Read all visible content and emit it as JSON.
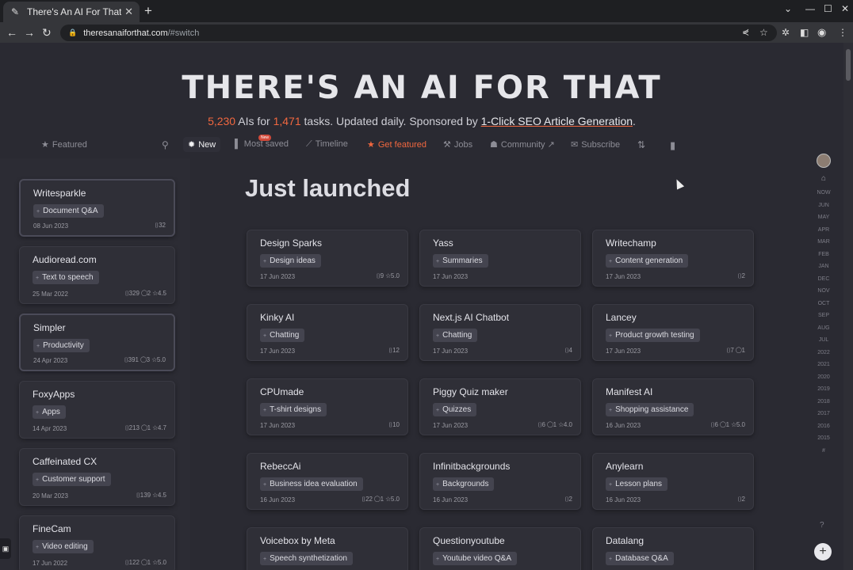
{
  "browser": {
    "tab_title": "There's An AI For That - Th",
    "new_tab": "+",
    "url_host": "theresanaiforthat.com",
    "url_path": "/#switch"
  },
  "hero": {
    "title": "THERE'S AN AI FOR THAT",
    "ai_count": "5,230",
    "ais_for": "AIs for",
    "task_count": "1,471",
    "tasks_text": "tasks. Updated daily. Sponsored by",
    "sponsor": "1-Click SEO Article Generation",
    "period": "."
  },
  "nav": {
    "featured": "Featured",
    "new": "New",
    "new_badge": "New",
    "most_saved": "Most saved",
    "timeline": "Timeline",
    "get_featured": "Get featured",
    "jobs": "Jobs",
    "community": "Community",
    "subscribe": "Subscribe"
  },
  "sidebar": {
    "items": [
      {
        "name": "Writesparkle",
        "tag": "Document Q&A",
        "date": "08 Jun 2023",
        "stats": "⌷32"
      },
      {
        "name": "Audioread.com",
        "tag": "Text to speech",
        "date": "25 Mar 2022",
        "stats": "⌷329  ◯2  ☆4.5"
      },
      {
        "name": "Simpler",
        "tag": "Productivity",
        "date": "24 Apr 2023",
        "stats": "⌷391  ◯3  ☆5.0"
      },
      {
        "name": "FoxyApps",
        "tag": "Apps",
        "date": "14 Apr 2023",
        "stats": "⌷213  ◯1  ☆4.7"
      },
      {
        "name": "Caffeinated CX",
        "tag": "Customer support",
        "date": "20 Mar 2023",
        "stats": "⌷139  ☆4.5"
      },
      {
        "name": "FineCam",
        "tag": "Video editing",
        "date": "17 Jun 2022",
        "stats": "⌷122  ◯1  ☆5.0"
      }
    ]
  },
  "main": {
    "title": "Just launched",
    "cards": [
      {
        "name": "Design Sparks",
        "tag": "Design ideas",
        "date": "17 Jun 2023",
        "stats": "⌷9  ☆5.0"
      },
      {
        "name": "Yass",
        "tag": "Summaries",
        "date": "17 Jun 2023",
        "stats": ""
      },
      {
        "name": "Writechamp",
        "tag": "Content generation",
        "date": "17 Jun 2023",
        "stats": "⌷2"
      },
      {
        "name": "Kinky AI",
        "tag": "Chatting",
        "date": "17 Jun 2023",
        "stats": "⌷12"
      },
      {
        "name": "Next.js AI Chatbot",
        "tag": "Chatting",
        "date": "17 Jun 2023",
        "stats": "⌷4"
      },
      {
        "name": "Lancey",
        "tag": "Product growth testing",
        "date": "17 Jun 2023",
        "stats": "⌷7  ◯1"
      },
      {
        "name": "CPUmade",
        "tag": "T-shirt designs",
        "date": "17 Jun 2023",
        "stats": "⌷10"
      },
      {
        "name": "Piggy Quiz maker",
        "tag": "Quizzes",
        "date": "17 Jun 2023",
        "stats": "⌷6  ◯1  ☆4.0"
      },
      {
        "name": "Manifest AI",
        "tag": "Shopping assistance",
        "date": "16 Jun 2023",
        "stats": "⌷6  ◯1  ☆5.0"
      },
      {
        "name": "RebeccAi",
        "tag": "Business idea evaluation",
        "date": "16 Jun 2023",
        "stats": "⌷22  ◯1  ☆5.0"
      },
      {
        "name": "Infinitbackgrounds",
        "tag": "Backgrounds",
        "date": "16 Jun 2023",
        "stats": "⌷2"
      },
      {
        "name": "Anylearn",
        "tag": "Lesson plans",
        "date": "16 Jun 2023",
        "stats": "⌷2"
      },
      {
        "name": "Voicebox by Meta",
        "tag": "Speech synthetization",
        "date": "",
        "stats": ""
      },
      {
        "name": "Questionyoutube",
        "tag": "Youtube video Q&A",
        "date": "",
        "stats": ""
      },
      {
        "name": "Datalang",
        "tag": "Database Q&A",
        "date": "",
        "stats": ""
      }
    ]
  },
  "timeline": {
    "labels": [
      "NOW",
      "JUN",
      "MAY",
      "APR",
      "MAR",
      "FEB",
      "JAN",
      "DEC",
      "NOV",
      "OCT",
      "SEP",
      "AUG",
      "JUL",
      "2022",
      "2021",
      "2020",
      "2019",
      "2018",
      "2017",
      "2016",
      "2015",
      "#"
    ],
    "help": "?",
    "add": "+"
  },
  "colors": {
    "accent": "#f0673f",
    "background": "#2a2a32",
    "card": "#2f2f37"
  }
}
